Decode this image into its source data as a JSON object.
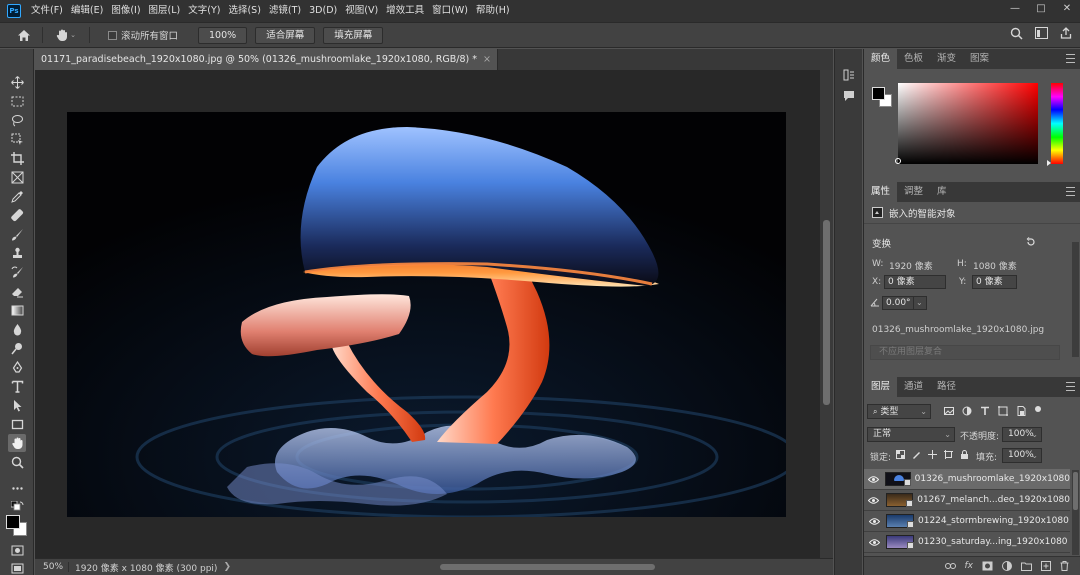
{
  "app": {
    "logo": "Ps"
  },
  "menu": [
    "文件(F)",
    "编辑(E)",
    "图像(I)",
    "图层(L)",
    "文字(Y)",
    "选择(S)",
    "滤镜(T)",
    "3D(D)",
    "视图(V)",
    "增效工具",
    "窗口(W)",
    "帮助(H)"
  ],
  "window_controls": {
    "minimize": "—",
    "restore": "□",
    "close": "✕"
  },
  "options": {
    "scroll_all_label": "滚动所有窗口",
    "zoom_100": "100%",
    "fit_screen": "适合屏幕",
    "fill_screen": "填充屏幕"
  },
  "document": {
    "tab_title": "01171_paradisebeach_1920x1080.jpg @ 50% (01326_mushroomlake_1920x1080, RGB/8) *",
    "close": "×"
  },
  "status": {
    "zoom": "50%",
    "doc_info": "1920 像素 x 1080 像素 (300 ppi)",
    "arrow": "❯"
  },
  "color_panel": {
    "tabs": [
      "颜色",
      "色板",
      "渐变",
      "图案"
    ],
    "active": 0
  },
  "properties": {
    "tabs": [
      "属性",
      "调整",
      "库"
    ],
    "type_label": "嵌入的智能对象",
    "transform_label": "变换",
    "w_label": "W:",
    "w_value": "1920 像素",
    "h_label": "H:",
    "h_value": "1080 像素",
    "x_label": "X:",
    "x_value": "0 像素",
    "y_label": "Y:",
    "y_value": "0 像素",
    "angle_value": "0.00°",
    "filename": "01326_mushroomlake_1920x1080.jpg",
    "comp_button": "不应用图层复合"
  },
  "layers": {
    "tabs": [
      "图层",
      "通道",
      "路径"
    ],
    "filter_kind": "类型",
    "blend_mode": "正常",
    "opacity_label": "不透明度:",
    "opacity_value": "100%",
    "lock_label": "锁定:",
    "fill_label": "填充:",
    "fill_value": "100%",
    "items": [
      {
        "name": "01326_mushroomlake_1920x1080",
        "selected": true,
        "thumb": "#101018"
      },
      {
        "name": "01267_melanch...deo_1920x1080",
        "selected": false,
        "thumb": "#6b4a2a"
      },
      {
        "name": "01224_stormbrewing_1920x1080",
        "selected": false,
        "thumb": "#2a4a7a"
      },
      {
        "name": "01230_saturday...ing_1920x1080",
        "selected": false,
        "thumb": "#5a5a8a"
      }
    ],
    "footer_fx": "fx"
  }
}
